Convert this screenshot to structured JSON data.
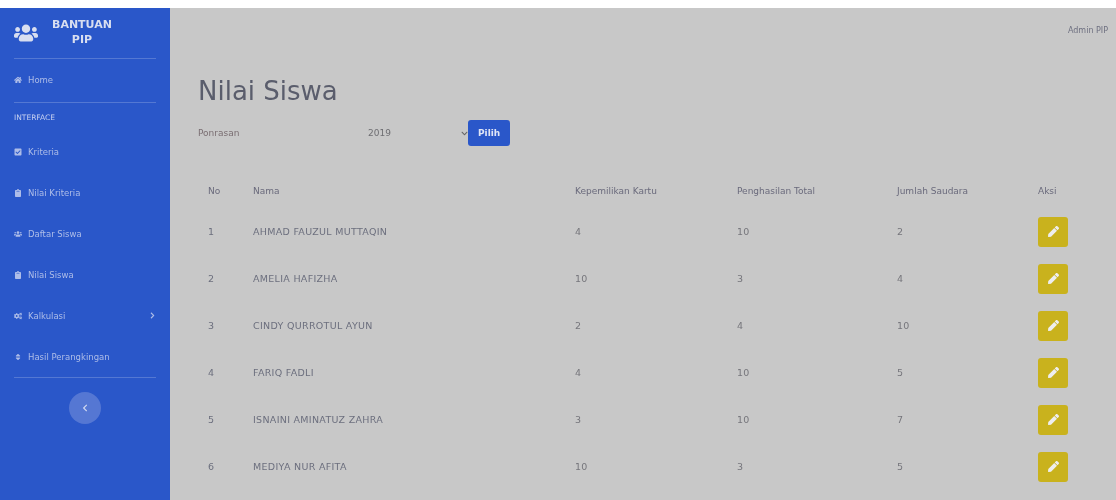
{
  "sidebar": {
    "brand": [
      "BANTUAN",
      "PIP"
    ],
    "items": [
      {
        "kind": "link",
        "label": "Home"
      },
      {
        "kind": "heading",
        "label": "INTERFACE"
      },
      {
        "kind": "link",
        "label": "Kriteria"
      },
      {
        "kind": "link",
        "label": "Nilai Kriteria"
      },
      {
        "kind": "link",
        "label": "Daftar Siswa"
      },
      {
        "kind": "link",
        "label": "Nilai Siswa"
      },
      {
        "kind": "link",
        "label": "Kalkulasi",
        "submenu": true
      },
      {
        "kind": "link",
        "label": "Hasil Perangkingan"
      }
    ]
  },
  "topbar": {
    "user": "Admin PIP"
  },
  "page_title": "Nilai Siswa",
  "filter": {
    "label": "Ponrasan",
    "year": "2019",
    "button": "Pilih"
  },
  "table": {
    "columns": [
      "No",
      "Nama",
      "Kepemilikan Kartu",
      "Penghasilan Total",
      "Jumlah Saudara",
      "Aksi"
    ],
    "rows": [
      [
        "1",
        "AHMAD FAUZUL MUTTAQIN",
        "4",
        "10",
        "2"
      ],
      [
        "2",
        "AMELIA HAFIZHA",
        "10",
        "3",
        "4"
      ],
      [
        "3",
        "CINDY QURROTUL AYUN",
        "2",
        "4",
        "10"
      ],
      [
        "4",
        "FARIQ FADLI",
        "4",
        "10",
        "5"
      ],
      [
        "5",
        "ISNAINI AMINATUZ ZAHRA",
        "3",
        "10",
        "7"
      ],
      [
        "6",
        "MEDIYA NUR AFITA",
        "10",
        "3",
        "5"
      ]
    ]
  }
}
